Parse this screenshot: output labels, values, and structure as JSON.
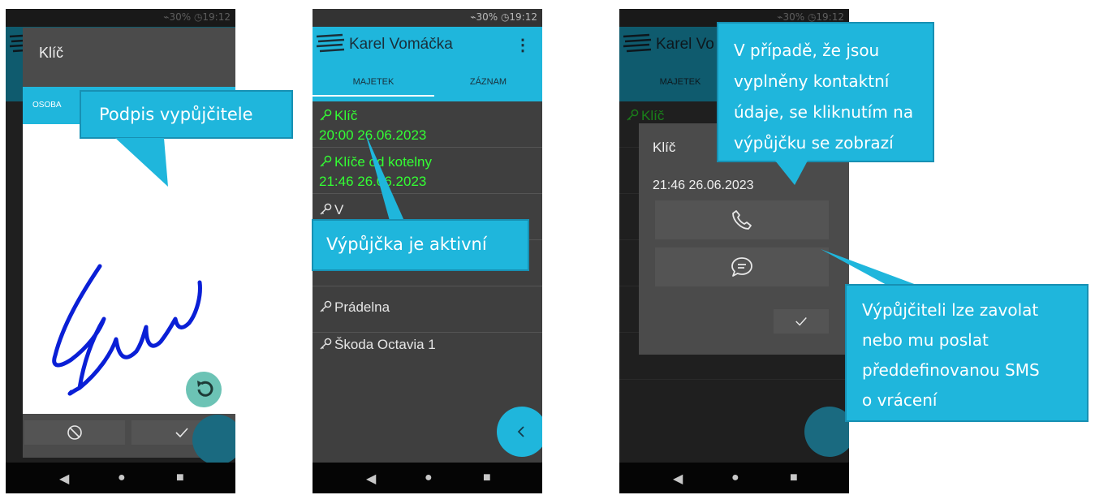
{
  "status": {
    "text": "⌁30% ◷19:12"
  },
  "phone1": {
    "dialog_title": "Klíč",
    "tab_label": "OSOBA",
    "callout": "Podpis vypůjčitele",
    "cancel_icon": "cancel-icon",
    "ok_icon": "check-icon",
    "undo_icon": "undo-icon"
  },
  "phone2": {
    "app_title": "Karel Vomáčka",
    "menu_icon": "more-vert-icon",
    "tabs": [
      "MAJETEK",
      "ZÁZNAM"
    ],
    "items": [
      {
        "name": "Klíč",
        "date": "20:00 26.06.2023",
        "active": true
      },
      {
        "name": "Klíče od kotelny",
        "date": "21:46 26.06.2023",
        "active": true
      },
      {
        "name": "V",
        "date": "",
        "active": false
      },
      {
        "name": "",
        "date": "",
        "active": false
      },
      {
        "name": "Prádelna",
        "date": "",
        "active": false
      },
      {
        "name": "Škoda Octavia 1",
        "date": "",
        "active": false
      }
    ],
    "callout": "Výpůjčka je aktivní",
    "fab_icon": "chevron-left-icon"
  },
  "phone3": {
    "app_title": "Karel Vo",
    "tab": "MAJETEK",
    "item_name": "Klíč",
    "dialog_title": "Klíč",
    "dialog_date": "21:46 26.06.2023",
    "call_icon": "phone-icon",
    "sms_icon": "message-icon",
    "ok_icon": "check-icon",
    "callout_top": [
      "V případě, že jsou",
      "vyplněny kontaktní",
      "údaje, se kliknutím na",
      "výpůjčku se zobrazí"
    ],
    "callout_bottom": [
      "Výpůjčiteli lze zavolat",
      "nebo mu poslat",
      "předdefinovanou SMS",
      "o vrácení"
    ]
  },
  "colors": {
    "accent": "#1fb6dc",
    "active_green": "#33ff33",
    "signature": "#0a1fd6",
    "background": "#3f3f3f"
  }
}
